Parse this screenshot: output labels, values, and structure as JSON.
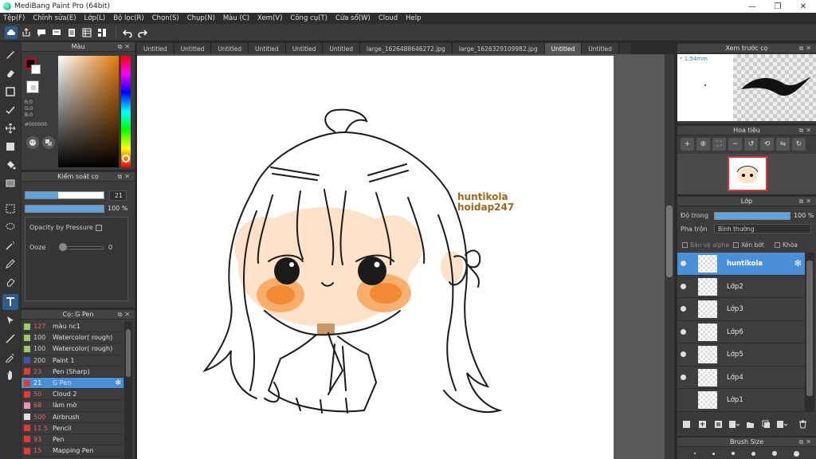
{
  "window": {
    "title": "MediBang Paint Pro (64bit)",
    "minimize": "—",
    "maximize": "❐",
    "close": "✕"
  },
  "menu": [
    "Tệp(F)",
    "Chỉnh sửa(E)",
    "Lớp(L)",
    "Bộ lọc(R)",
    "Chọn(S)",
    "Chụp(N)",
    "Màu (C)",
    "Xem(V)",
    "Công cụ(T)",
    "Cửa sổ(W)",
    "Cloud",
    "Help"
  ],
  "tabs": [
    {
      "label": "Untitled"
    },
    {
      "label": "Untitled"
    },
    {
      "label": "Untitled"
    },
    {
      "label": "Untitled"
    },
    {
      "label": "Untitled"
    },
    {
      "label": "Untitled"
    },
    {
      "label": "large_1626488646272.jpg"
    },
    {
      "label": "large_1626329109982.jpg"
    },
    {
      "label": "Untitled",
      "active": true
    },
    {
      "label": "Untitled"
    }
  ],
  "color_panel": {
    "title": "Màu",
    "r": "R:0",
    "g": "G:0",
    "b": "B:0",
    "hex": "#000000",
    "base_hue": "#e47a0c"
  },
  "brush_control": {
    "title": "Kiểm soát cọ",
    "size_value": "21",
    "size_fraction": 0.42,
    "opacity_value": "100 %",
    "opacity_fraction": 1.0,
    "opacity_by_pressure": "Opacity by Pressure",
    "ooze_label": "Ooze",
    "ooze_value": "0"
  },
  "brush_list": {
    "title": "Cọ: G Pen",
    "items": [
      {
        "size": "127",
        "name": "màu nc1",
        "color": "#9ccc65"
      },
      {
        "size": "100",
        "name": "Watercolor( rough)",
        "color": "#9ccc65"
      },
      {
        "size": "100",
        "name": "Watercolor( rough)",
        "color": "#9ccc65"
      },
      {
        "size": "200",
        "name": "Paint 1",
        "color": "#3f51b5"
      },
      {
        "size": "23",
        "name": "Pen (Sharp)",
        "color": "#e53935"
      },
      {
        "size": "21",
        "name": "G Pen",
        "color": "#e53935",
        "selected": true
      },
      {
        "size": "50",
        "name": "Cloud 2",
        "color": "#e53935"
      },
      {
        "size": "68",
        "name": "làm mờ",
        "color": "#f48fb1"
      },
      {
        "size": "500",
        "name": "Airbrush",
        "color": "#e0e0e0"
      },
      {
        "size": "11.5",
        "name": "Pencil",
        "color": "#e53935"
      },
      {
        "size": "93",
        "name": "Pen",
        "color": "#e53935"
      },
      {
        "size": "15",
        "name": "Mapping Pen",
        "color": "#e53935"
      }
    ]
  },
  "canvas": {
    "watermark_line1": "huntikola",
    "watermark_line2": "hoidap247"
  },
  "preview": {
    "title": "Xem trước cọ",
    "size_label": "* 1.54mm"
  },
  "navigator": {
    "title": "Hoa tiêu"
  },
  "layers": {
    "title": "Lớp",
    "opacity_label": "Độ trong",
    "opacity_value": "100 %",
    "opacity_fraction": 1.0,
    "blend_label": "Pha trộn",
    "blend_value": "Bình thường",
    "protect_alpha": "Bảo vệ alpha",
    "clipping": "Xén bớt",
    "lock": "Khóa",
    "items": [
      {
        "name": "huntikola",
        "selected": true,
        "visible": true
      },
      {
        "name": "Lớp2",
        "visible": true
      },
      {
        "name": "Lớp3",
        "visible": true
      },
      {
        "name": "Lớp6",
        "visible": true
      },
      {
        "name": "Lớp5",
        "visible": true
      },
      {
        "name": "Lớp4",
        "visible": true
      },
      {
        "name": "Lớp1",
        "visible": false
      }
    ]
  },
  "brush_size": {
    "title": "Brush Size"
  }
}
